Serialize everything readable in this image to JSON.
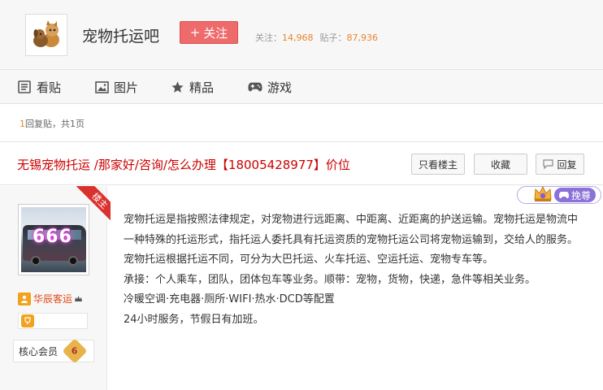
{
  "header": {
    "forum_name": "宠物托运吧",
    "follow_label": "关注",
    "follow_prefix": "+",
    "followers_label": "关注：",
    "followers_count": "14,968",
    "posts_label": "贴子：",
    "posts_count": "87,936"
  },
  "nav": {
    "items": [
      {
        "label": "看贴",
        "icon": "list-icon"
      },
      {
        "label": "图片",
        "icon": "image-icon"
      },
      {
        "label": "精品",
        "icon": "star-icon"
      },
      {
        "label": "游戏",
        "icon": "gamepad-icon"
      }
    ]
  },
  "pager": {
    "reply_count": "1",
    "reply_label": "回复贴，共",
    "page_count": "1",
    "page_label": "页"
  },
  "thread": {
    "title": "无锡宠物托运 /那家好/咨询/怎么办理【18005428977】价位",
    "only_owner_label": "只看楼主",
    "favorite_label": "收藏",
    "reply_label": "回复"
  },
  "post": {
    "louzhu_label": "楼主",
    "avatar_text": "666",
    "username": "华辰客运",
    "member_label": "核心会员",
    "level": "6",
    "vip_label": "挽尊",
    "paragraphs": [
      "宠物托运是指按照法律规定，对宠物进行远距离、中距离、近距离的护送运输。宠物托运是物流中一种特殊的托运形式，指托运人委托具有托运资质的宠物托运公司将宠物运输到，交给人的服务。",
      "宠物托运根据托运不同，可分为大巴托运、火车托运、空运托运、宠物专车等。",
      "承接：个人乘车，团队，团体包车等业务。顺带：宠物，货物，快递，急件等相关业务。",
      "冷暖空调·充电器·厕所·WIFI·热水·DCD等配置",
      "24小时服务，节假日有加班。"
    ]
  },
  "colors": {
    "accent_red": "#c00",
    "follow_button": "#ef6a6a",
    "count_orange": "#e8862a",
    "vip_purple": "#8b72d9"
  }
}
